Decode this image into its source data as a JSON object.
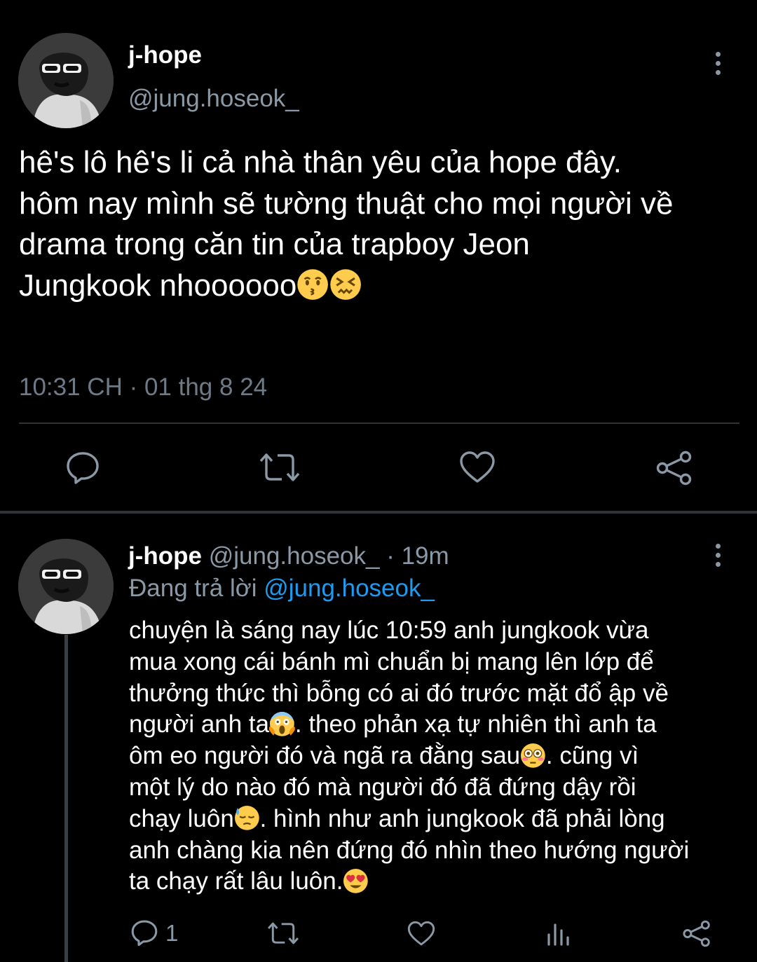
{
  "theme": {
    "background": "#000000",
    "text_primary": "#ffffff",
    "text_secondary": "#8b98a5",
    "link": "#1d9bf0",
    "divider": "#2f3336"
  },
  "main_tweet": {
    "display_name": "j-hope",
    "handle": "@jung.hoseok_",
    "text_lines": [
      "hê's lô hê's li cả nhà thân yêu của hope đây.",
      "hôm nay mình sẽ tường thuật cho mọi người về",
      "drama trong căn tin của trapboy Jeon",
      "Jungkook nhoooooo"
    ],
    "trailing_emojis": [
      "kissing-face-emoji",
      "confounded-face-emoji"
    ],
    "timestamp": "10:31 CH · 01 thg 8 24",
    "icons": [
      "reply-icon",
      "retweet-icon",
      "like-icon",
      "share-icon",
      "more-icon"
    ]
  },
  "reply_tweet": {
    "display_name": "j-hope",
    "handle": "@jung.hoseok_",
    "separator": " · ",
    "time": "19m",
    "replying_label": "Đang trả lời ",
    "replying_handle": "@jung.hoseok_",
    "text": {
      "l1": "chuyện là sáng nay lúc 10:59 anh jungkook vừa",
      "l2": "mua xong cái bánh mì chuẩn bị mang lên lớp để",
      "l3": "thưởng thức thì bỗng có ai đó trước mặt đổ ập về",
      "l4a": "người anh ta",
      "l4b": ". theo phản xạ tự nhiên thì anh ta",
      "l5a": "ôm eo người đó và ngã ra đằng sau",
      "l5b": ". cũng vì",
      "l6": "một lý do nào đó mà người đó đã đứng dậy rồi",
      "l7a": "chạy luôn",
      "l7b": ". hình như anh jungkook đã phải lòng",
      "l8": "anh chàng kia nên đứng đó nhìn theo hướng người",
      "l9a": "ta chạy rất lâu luôn."
    },
    "inline_emojis": [
      "screaming-face-emoji",
      "flushed-face-emoji",
      "downcast-sweat-face-emoji",
      "heart-eyes-face-emoji"
    ],
    "reply_count": "1",
    "icons": [
      "reply-icon",
      "retweet-icon",
      "like-icon",
      "views-icon",
      "share-icon",
      "more-icon"
    ]
  }
}
